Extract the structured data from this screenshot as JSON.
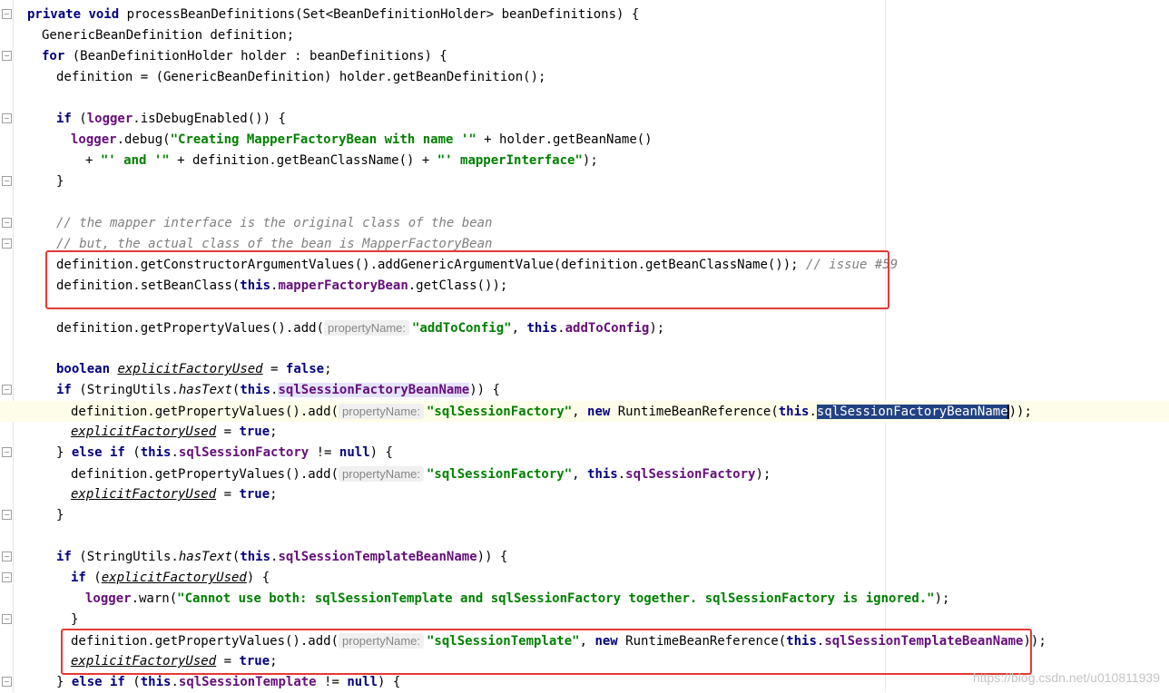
{
  "code": {
    "l1": {
      "kw_private": "private",
      "kw_void": "void",
      "name": " processBeanDefinitions(Set<BeanDefinitionHolder> beanDefinitions) {"
    },
    "l2": {
      "text": "GenericBeanDefinition definition;"
    },
    "l3": {
      "kw_for": "for",
      "rest": " (BeanDefinitionHolder holder : beanDefinitions) {"
    },
    "l4": {
      "text": "definition = (GenericBeanDefinition) holder.getBeanDefinition();"
    },
    "l6": {
      "kw_if": "if",
      "p1": " (",
      "logger": "logger",
      "p2": ".isDebugEnabled()) {"
    },
    "l7": {
      "logger": "logger",
      "p1": ".debug(",
      "s1": "\"Creating MapperFactoryBean with name '\"",
      "p2": " + holder.getBeanName()"
    },
    "l8": {
      "p1": "+ ",
      "s1": "\"' and '\"",
      "p2": " + definition.getBeanClassName() + ",
      "s2": "\"' mapperInterface\"",
      "p3": ");"
    },
    "l9": {
      "text": "}"
    },
    "l11": {
      "text": "// the mapper interface is the original class of the bean"
    },
    "l12": {
      "text": "// but, the actual class of the bean is MapperFactoryBean"
    },
    "l13": {
      "p1": "definition.getConstructorArgumentValues().addGenericArgumentValue(definition.getBeanClassName()); ",
      "cmt": "// issue #59"
    },
    "l14": {
      "p1": "definition.setBeanClass(",
      "kw": "this",
      "dot": ".",
      "fld": "mapperFactoryBean",
      "p2": ".getClass());"
    },
    "l16": {
      "p1": "definition.getPropertyValues().add(",
      "hint": "propertyName:",
      "s1": "\"addToConfig\"",
      "p2": ", ",
      "kw": "this",
      "dot": ".",
      "fld": "addToConfig",
      "p3": ");"
    },
    "l18": {
      "kw": "boolean",
      "sp": " ",
      "var": "explicitFactoryUsed",
      "p1": " = ",
      "kw2": "false",
      "p2": ";"
    },
    "l19": {
      "kw": "if",
      "p1": " (StringUtils.",
      "method": "hasText",
      "p2": "(",
      "kw2": "this",
      "dot": ".",
      "fld": "sqlSessionFactoryBeanName",
      "p3": ")) {"
    },
    "l20": {
      "p1": "definition.getPropertyValues().add(",
      "hint": "propertyName:",
      "s1": "\"sqlSessionFactory\"",
      "p2": ", ",
      "kw_new": "new",
      "p3": " RuntimeBeanReference(",
      "kw": "this",
      "dot": ".",
      "sel": "sqlSessionFactoryBeanName",
      "p4": "));"
    },
    "l21": {
      "var": "explicitFactoryUsed",
      "p1": " = ",
      "kw": "true",
      "p2": ";"
    },
    "l22": {
      "p1": "} ",
      "kw": "else if",
      "p2": " (",
      "kw2": "this",
      "dot": ".",
      "fld": "sqlSessionFactory",
      "p3": " != ",
      "kw3": "null",
      "p4": ") {"
    },
    "l23": {
      "p1": "definition.getPropertyValues().add(",
      "hint": "propertyName:",
      "s1": "\"sqlSessionFactory\"",
      "p2": ", ",
      "kw": "this",
      "dot": ".",
      "fld": "sqlSessionFactory",
      "p3": ");"
    },
    "l24": {
      "var": "explicitFactoryUsed",
      "p1": " = ",
      "kw": "true",
      "p2": ";"
    },
    "l25": {
      "text": "}"
    },
    "l27": {
      "kw": "if",
      "p1": " (StringUtils.",
      "method": "hasText",
      "p2": "(",
      "kw2": "this",
      "dot": ".",
      "fld": "sqlSessionTemplateBeanName",
      "p3": ")) {"
    },
    "l28": {
      "kw": "if",
      "p1": " (",
      "var": "explicitFactoryUsed",
      "p2": ") {"
    },
    "l29": {
      "logger": "logger",
      "p1": ".warn(",
      "s1": "\"Cannot use both: sqlSessionTemplate and sqlSessionFactory together. sqlSessionFactory is ignored.\"",
      "p2": ");"
    },
    "l30": {
      "text": "}"
    },
    "l31": {
      "p1": "definition.getPropertyValues().add(",
      "hint": "propertyName:",
      "s1": "\"sqlSessionTemplate\"",
      "p2": ", ",
      "kw_new": "new",
      "p3": " RuntimeBeanReference(",
      "kw": "this",
      "dot": ".",
      "fld": "sqlSessionTemplateBeanName",
      "p4": "));"
    },
    "l32": {
      "var": "explicitFactoryUsed",
      "p1": " = ",
      "kw": "true",
      "p2": ";"
    },
    "l33": {
      "p1": "} ",
      "kw": "else if",
      "p2": " (",
      "kw2": "this",
      "dot": ".",
      "fld": "sqlSessionTemplate",
      "p3": " != ",
      "kw3": "null",
      "p4": ") {"
    }
  },
  "watermark": "https://blog.csdn.net/u010811939",
  "colors": {
    "keyword": "#000080",
    "field": "#660e7a",
    "string": "#008000",
    "comment": "#808080",
    "highlight_box": "#e53935"
  }
}
